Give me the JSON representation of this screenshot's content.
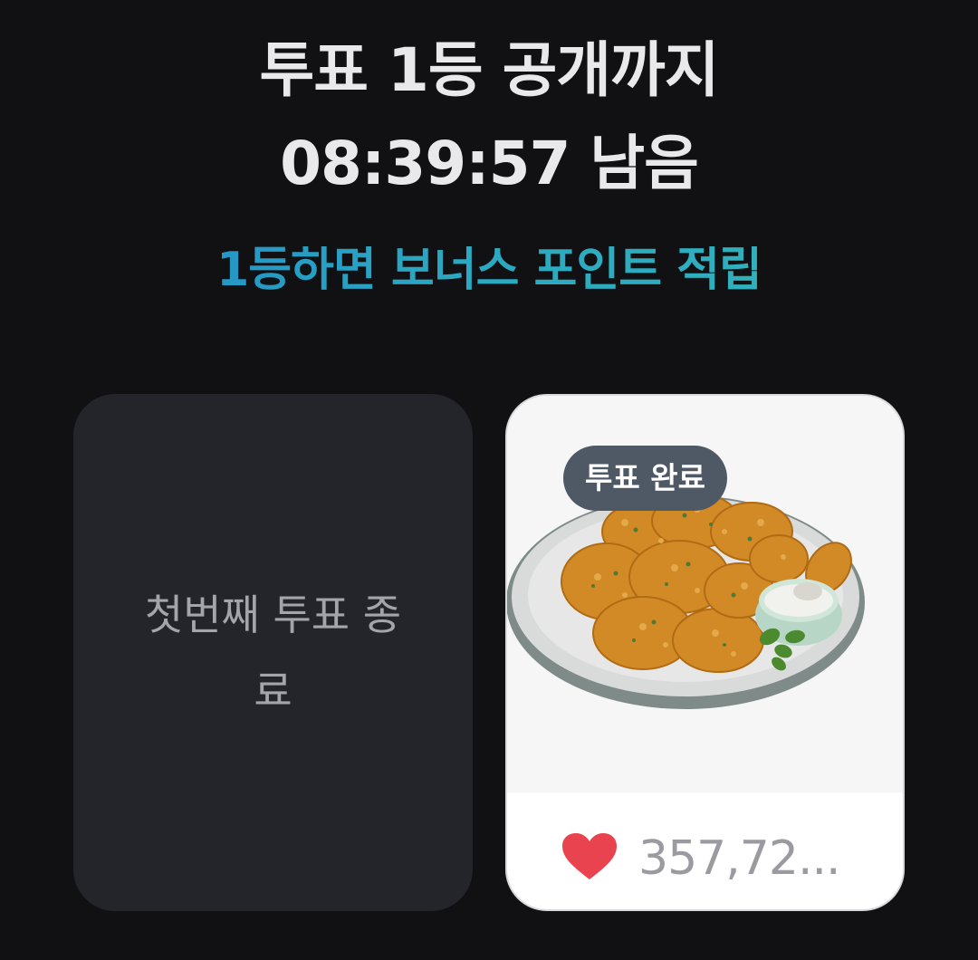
{
  "header": {
    "title_line1": "투표 1등 공개까지",
    "title_line2": "08:39:57 남음",
    "promo": "1등하면 보너스 포인트 적립"
  },
  "cards": {
    "closed": {
      "text": "첫번째 투표 종료"
    },
    "voted": {
      "badge": "투표 완료",
      "image_icon": "fried-chicken-photo",
      "like_icon": "heart-icon",
      "like_count": "357,72..."
    }
  },
  "colors": {
    "background": "#111113",
    "closed_card": "#24252a",
    "promo_start": "#1f87c9",
    "promo_end": "#33b5b8",
    "badge": "#4f5966",
    "heart": "#e8434f"
  }
}
